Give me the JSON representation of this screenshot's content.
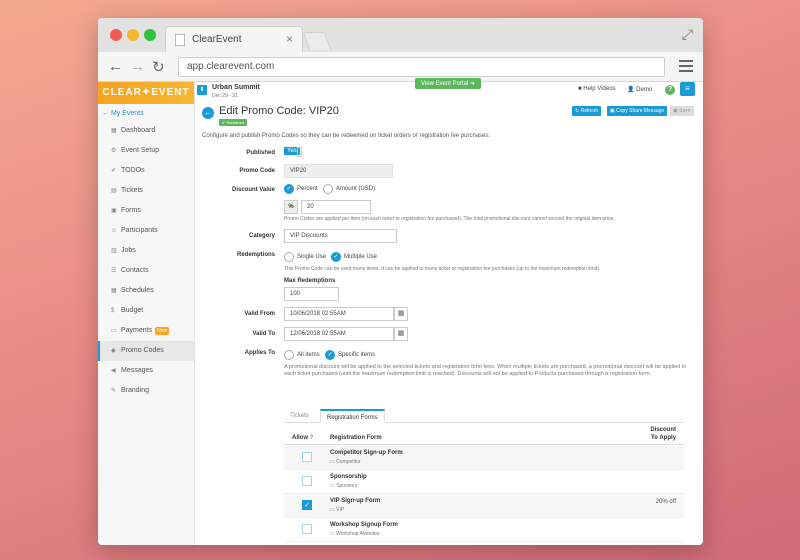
{
  "browser": {
    "tab_title": "ClearEvent",
    "url": "app.clearevent.com"
  },
  "sidebar": {
    "logo": "CLEAR✦EVENT",
    "my_events": "My Events",
    "items": [
      {
        "label": "Dashboard",
        "icon": "dashboard-icon"
      },
      {
        "label": "Event Setup",
        "icon": "cog-icon"
      },
      {
        "label": "TODOs",
        "icon": "todo-icon"
      },
      {
        "label": "Tickets",
        "icon": "ticket-icon"
      },
      {
        "label": "Forms",
        "icon": "form-icon"
      },
      {
        "label": "Participants",
        "icon": "users-icon"
      },
      {
        "label": "Jobs",
        "icon": "jobs-icon"
      },
      {
        "label": "Contacts",
        "icon": "contacts-icon"
      },
      {
        "label": "Schedules",
        "icon": "calendar-icon"
      },
      {
        "label": "Budget",
        "icon": "dollar-icon"
      },
      {
        "label": "Payments",
        "icon": "card-icon",
        "badge": "New"
      },
      {
        "label": "Promo Codes",
        "icon": "tag-icon",
        "active": true
      },
      {
        "label": "Messages",
        "icon": "megaphone-icon"
      },
      {
        "label": "Branding",
        "icon": "brush-icon"
      }
    ]
  },
  "header": {
    "event_name": "Urban Summit",
    "event_dates": "Dec 29 - 31",
    "portal_button": "View Event Portal",
    "help_videos": "Help Videos",
    "user": "Demo"
  },
  "page": {
    "title": "Edit Promo Code: VIP20",
    "status_badge": "Published",
    "refresh": "Refresh",
    "copy_share": "Copy Share Message",
    "save": "Save",
    "description": "Configure and publish Promo Codes so they can be redeemed on ticket orders or registration fee purchases."
  },
  "form": {
    "published_label": "Published",
    "published_value": "Yes",
    "promo_code_label": "Promo Code",
    "promo_code_value": "VIP20",
    "discount_label": "Discount Value",
    "discount_percent": "Percent",
    "discount_amount": "Amount (USD)",
    "discount_symbol": "%",
    "discount_value": "20",
    "discount_help": "Promo Codes are applied per item (on each ticket or registration fee purchased). The total promotional discount cannot exceed the original item price.",
    "category_label": "Category",
    "category_value": "VIP Discounts",
    "redemptions_label": "Redemptions",
    "single_use": "Single Use",
    "multiple_use": "Multiple Use",
    "redemptions_help": "This Promo Code can be used many times. It can be applied to many ticket or registration fee purchases (up to the maximum redemption limit).",
    "max_redemptions_label": "Max Redemptions",
    "max_redemptions_value": "100",
    "valid_from_label": "Valid From",
    "valid_from_value": "10/06/2018 02:55AM",
    "valid_to_label": "Valid To",
    "valid_to_value": "12/06/2018 02:55AM",
    "applies_to_label": "Applies To",
    "all_items": "All items",
    "specific_items": "Specific items",
    "applies_help": "A promotional discount will be applied to the selected tickets and registration form fees. When multiple tickets are purchased, a promotional discount will be applied to each ticket purchased (until the maximum redemption limit is reached). Discounts will not be applied to Products purchased through a registration form."
  },
  "tabs": [
    "Tickets",
    "Registration Forms"
  ],
  "table": {
    "col_allow": "Allow",
    "col_form": "Registration Form",
    "col_discount_1": "Discount",
    "col_discount_2": "To Apply",
    "rows": [
      {
        "name": "Competitor Sign-up Form",
        "sub": "Competitor",
        "checked": false,
        "discount": ""
      },
      {
        "name": "Sponsorship",
        "sub": "Sponsors",
        "checked": false,
        "discount": ""
      },
      {
        "name": "VIP Sign-up Form",
        "sub": "VIP",
        "checked": true,
        "discount": "20% off"
      },
      {
        "name": "Workshop Signup Form",
        "sub": "Workshop Attendee",
        "checked": false,
        "discount": ""
      }
    ]
  },
  "colors": {
    "accent": "#1a9ad6",
    "success": "#5cb85c",
    "brand": "#f6a21f"
  }
}
